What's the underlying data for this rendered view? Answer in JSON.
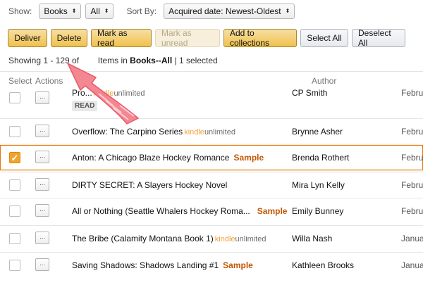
{
  "filters": {
    "show_label": "Show:",
    "show_value": "Books",
    "show_all_value": "All",
    "sort_label": "Sort By:",
    "sort_value": "Acquired date: Newest-Oldest"
  },
  "toolbar": {
    "deliver": "Deliver",
    "delete": "Delete",
    "mark_read": "Mark as read",
    "mark_unread": "Mark as unread",
    "add_collections": "Add to collections",
    "select_all": "Select All",
    "deselect_all": "Deselect All"
  },
  "status": {
    "prefix": "Showing 1 - 129 of",
    "count_hidden": "129",
    "middle": "Items in",
    "books": "Books",
    "sep": "--",
    "all": "All",
    "selected": "| 1 selected"
  },
  "headers": {
    "select": "Select",
    "actions": "Actions",
    "author": "Author"
  },
  "rows": [
    {
      "title": "Pro...",
      "ku": true,
      "sample": "",
      "author": "CP Smith",
      "date": "Februa",
      "badge": "READ",
      "checked": false
    },
    {
      "title": "Overflow: The Carpino Series",
      "ku": true,
      "sample": "",
      "author": "Brynne Asher",
      "date": "Februa",
      "checked": false
    },
    {
      "title": "Anton: A Chicago Blaze Hockey Romance",
      "ku": false,
      "sample": "Sample",
      "author": "Brenda Rothert",
      "date": "Februa",
      "checked": true
    },
    {
      "title": "DIRTY SECRET: A Slayers Hockey Novel",
      "ku": false,
      "sample": "",
      "author": "Mira Lyn Kelly",
      "date": "Februa",
      "checked": false
    },
    {
      "title": "All or Nothing (Seattle Whalers Hockey Roma...",
      "ku": false,
      "sample": "Sample",
      "author": "Emily Bunney",
      "date": "Februa",
      "checked": false
    },
    {
      "title": "The Bribe (Calamity Montana Book 1)",
      "ku": true,
      "sample": "",
      "author": "Willa Nash",
      "date": "Januar",
      "checked": false
    },
    {
      "title": "Saving Shadows: Shadows Landing #1",
      "ku": false,
      "sample": "Sample",
      "author": "Kathleen Brooks",
      "date": "Januar",
      "checked": false
    }
  ],
  "kindle_unlimited": {
    "kindle": "kindle",
    "unlimited": "unlimited"
  },
  "action_glyph": "...",
  "check_glyph": "✓",
  "colors": {
    "amazon_button": "#f0c14b",
    "sample": "#c45500",
    "selected_border": "#e77600",
    "arrow": "#f06b7a",
    "ku_kindle": "#f0a23b"
  },
  "icons": {
    "dropdown": "chevron-updown-icon",
    "annotation": "pink-arrow-icon"
  }
}
